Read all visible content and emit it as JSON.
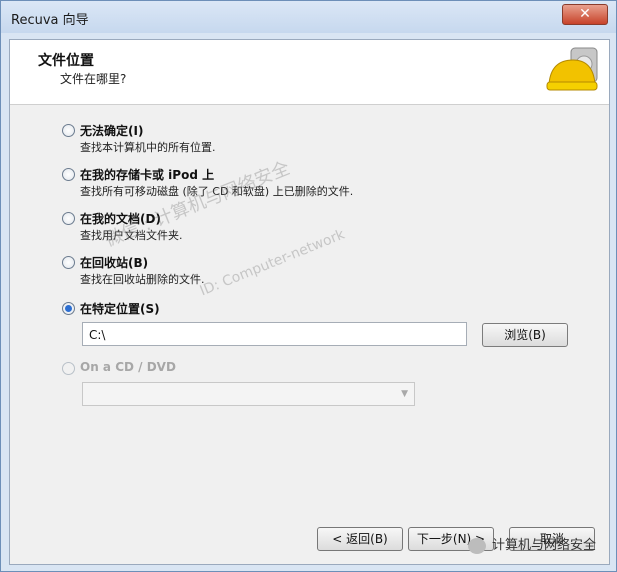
{
  "window": {
    "title": "Recuva 向导",
    "close_label": "✕"
  },
  "header": {
    "title": "文件位置",
    "subtitle": "文件在哪里?"
  },
  "options": [
    {
      "label": "无法确定(I)",
      "desc": "查找本计算机中的所有位置."
    },
    {
      "label": "在我的存储卡或 iPod 上",
      "desc": "查找所有可移动磁盘 (除了 CD 和软盘) 上已删除的文件."
    },
    {
      "label": "在我的文档(D)",
      "desc": "查找用户文档文件夹."
    },
    {
      "label": "在回收站(B)",
      "desc": "查找在回收站删除的文件."
    },
    {
      "label": "在特定位置(S)"
    },
    {
      "label": "On a CD / DVD"
    }
  ],
  "path": {
    "value": "C:\\"
  },
  "browse_label": "浏览(B)",
  "footer": {
    "back_label": "< 返回(B)",
    "next_label": "下一步(N) >",
    "cancel_label": "取消"
  },
  "watermark": {
    "line1": "微信 : 计算机与网络安全",
    "line2": "ID: Computer-network"
  },
  "wechat_badge": {
    "text": "计算机与网络安全"
  },
  "selected_option": "在特定位置(S)"
}
